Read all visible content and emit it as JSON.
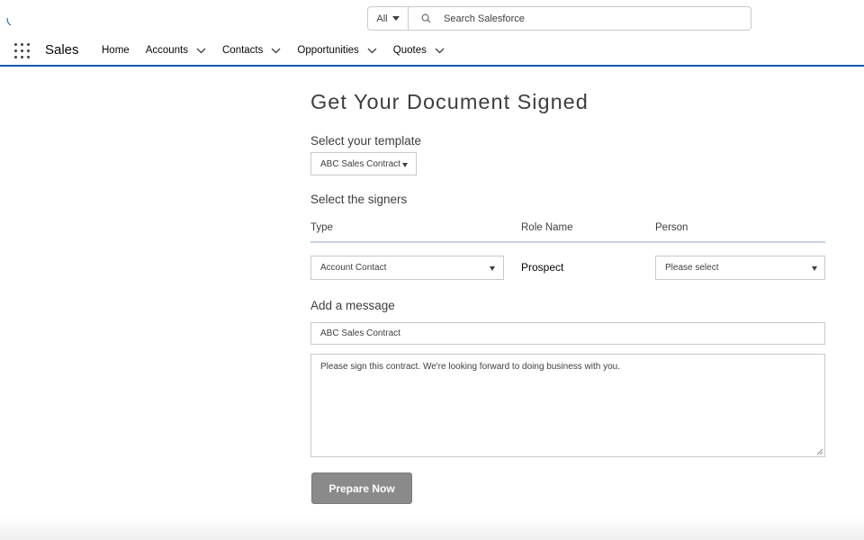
{
  "search": {
    "scope": "All",
    "placeholder": "Search Salesforce"
  },
  "nav": {
    "app_name": "Sales",
    "items": [
      {
        "label": "Home",
        "has_dropdown": false
      },
      {
        "label": "Accounts",
        "has_dropdown": true
      },
      {
        "label": "Contacts",
        "has_dropdown": true
      },
      {
        "label": "Opportunities",
        "has_dropdown": true
      },
      {
        "label": "Quotes",
        "has_dropdown": true
      }
    ]
  },
  "form": {
    "title": "Get Your Document Signed",
    "template_label": "Select your template",
    "template_value": "ABC Sales Contract",
    "signers_label": "Select the signers",
    "columns": {
      "type": "Type",
      "role": "Role Name",
      "person": "Person"
    },
    "signer_row": {
      "type_value": "Account Contact",
      "role_value": "Prospect",
      "person_value": "Please select"
    },
    "message_label": "Add a message",
    "subject_value": "ABC Sales Contract",
    "message_value": "Please sign this contract. We're looking forward to doing business with you.",
    "submit_label": "Prepare Now"
  },
  "colors": {
    "accent": "#0b5cab",
    "button": "#8a8a8a",
    "border": "#c9c9c9",
    "text": "#3e3e3c"
  }
}
